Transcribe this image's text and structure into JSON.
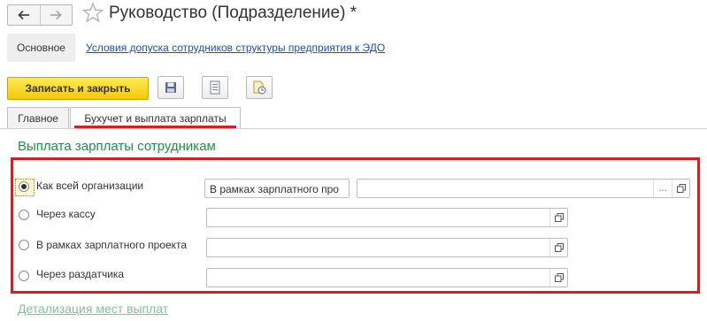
{
  "window": {
    "title": "Руководство (Подразделение) *"
  },
  "nav": {
    "back_icon": "arrow-left-icon",
    "forward_icon": "arrow-right-icon",
    "favorite_icon": "star-icon"
  },
  "top_tabs": [
    {
      "label": "Основное",
      "active": true
    },
    {
      "label": "Условия допуска сотрудников структуры предприятия к ЭДО"
    }
  ],
  "toolbar": {
    "save_close_label": "Записать и закрыть",
    "icons": [
      "save-disk-icon",
      "list-document-icon",
      "report-document-icon"
    ]
  },
  "form_tabs": [
    {
      "label": "Главное",
      "active": false
    },
    {
      "label": "Бухучет и выплата зарплаты",
      "active": true
    }
  ],
  "section_title": "Выплата зарплаты сотрудникам",
  "payment_options": [
    {
      "label": "Как всей организации",
      "checked": true,
      "field_value": "В рамках зарплатного про",
      "field2_value": ""
    },
    {
      "label": "Через кассу",
      "checked": false,
      "field_value": ""
    },
    {
      "label": "В рамках зарплатного проекта",
      "checked": false,
      "field_value": ""
    },
    {
      "label": "Через раздатчика",
      "checked": false,
      "field_value": ""
    }
  ],
  "select_button_label": "...",
  "details_link": "Детализация мест выплат",
  "colors": {
    "accent_red": "#d42020",
    "section_green": "#1e9146",
    "link_blue": "#1a4fbf",
    "save_yellow": "#f3c80a"
  }
}
